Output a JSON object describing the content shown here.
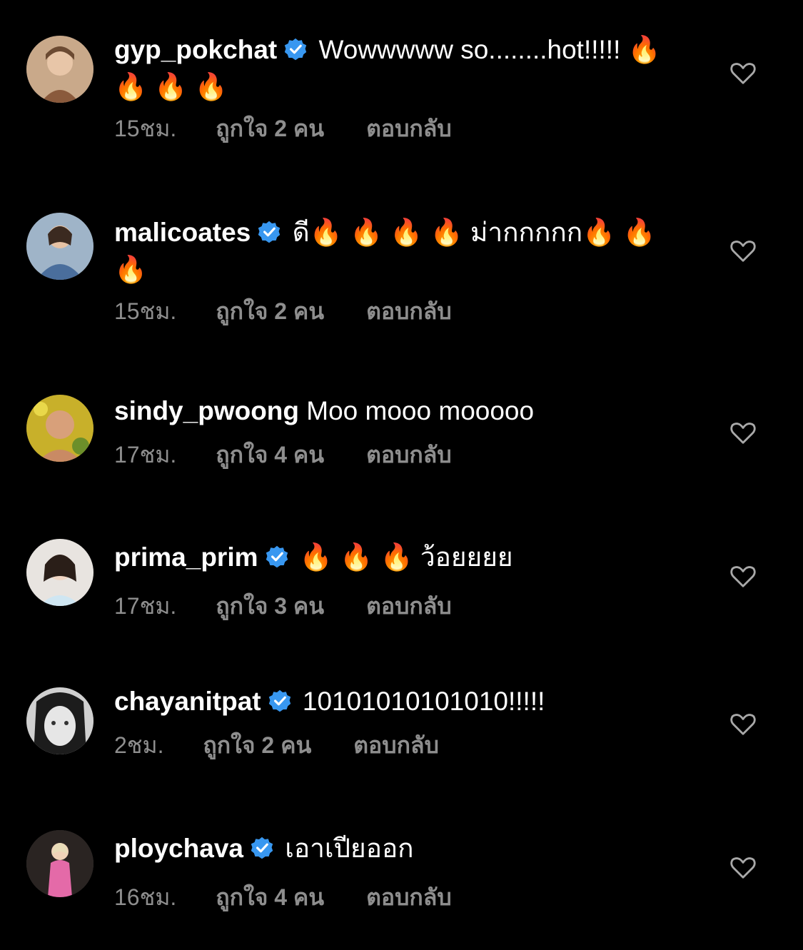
{
  "colors": {
    "background": "#000000",
    "text": "#ffffff",
    "meta": "#8e8e8e",
    "verified": "#3897f0",
    "heart_outline": "#a8a8a8"
  },
  "icons": {
    "verified": "verified-badge-icon",
    "like": "heart-outline-icon",
    "fire": "fire-emoji"
  },
  "comments": [
    {
      "username": "gyp_pokchat",
      "verified": true,
      "text": "Wowwwww so........hot!!!!! 🔥 🔥 🔥 🔥",
      "time": "15ชม.",
      "likes": "ถูกใจ 2 คน",
      "reply": "ตอบกลับ"
    },
    {
      "username": "malicoates",
      "verified": true,
      "text": "ดี🔥 🔥 🔥 🔥 ม่ากกกกก🔥 🔥 🔥",
      "time": "15ชม.",
      "likes": "ถูกใจ 2 คน",
      "reply": "ตอบกลับ"
    },
    {
      "username": "sindy_pwoong",
      "verified": false,
      "text": "Moo mooo mooooo",
      "time": "17ชม.",
      "likes": "ถูกใจ 4 คน",
      "reply": "ตอบกลับ"
    },
    {
      "username": "prima_prim",
      "verified": true,
      "text": "🔥 🔥 🔥 ว้อยยยย",
      "time": "17ชม.",
      "likes": "ถูกใจ 3 คน",
      "reply": "ตอบกลับ"
    },
    {
      "username": "chayanitpat",
      "verified": true,
      "text": "10101010101010!!!!!",
      "time": "2ชม.",
      "likes": "ถูกใจ 2 คน",
      "reply": "ตอบกลับ"
    },
    {
      "username": "ploychava",
      "verified": true,
      "text": "เอาเปียออก",
      "time": "16ชม.",
      "likes": "ถูกใจ 4 คน",
      "reply": "ตอบกลับ"
    }
  ]
}
